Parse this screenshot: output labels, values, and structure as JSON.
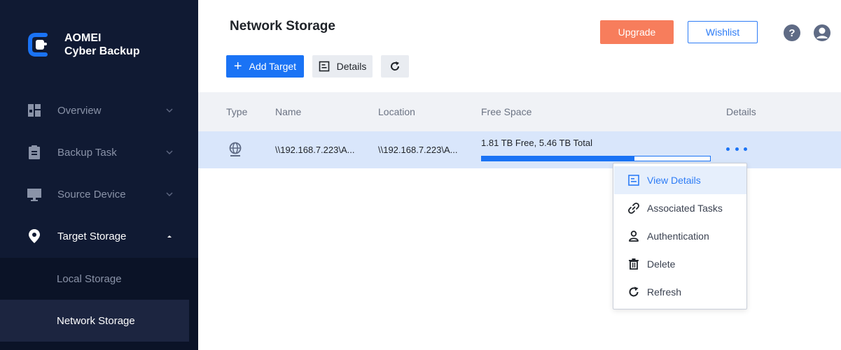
{
  "brand": {
    "line1": "AOMEI",
    "line2": "Cyber Backup"
  },
  "sidebar": {
    "items": [
      {
        "label": "Overview",
        "icon": "overview-icon"
      },
      {
        "label": "Backup Task",
        "icon": "clipboard-icon"
      },
      {
        "label": "Source Device",
        "icon": "monitor-icon"
      },
      {
        "label": "Target Storage",
        "icon": "location-pin-icon"
      }
    ],
    "submenu": [
      {
        "label": "Local Storage"
      },
      {
        "label": "Network Storage"
      }
    ]
  },
  "header": {
    "title": "Network Storage",
    "upgrade_label": "Upgrade",
    "wishlist_label": "Wishlist"
  },
  "toolbar": {
    "add_label": "Add Target",
    "details_label": "Details"
  },
  "table": {
    "columns": [
      "Type",
      "Name",
      "Location",
      "Free Space",
      "Details"
    ],
    "rows": [
      {
        "type_icon": "globe-icon",
        "name": "\\\\192.168.7.223\\A...",
        "location": "\\\\192.168.7.223\\A...",
        "free_space": "1.81 TB Free, 5.46 TB Total",
        "used_fraction": 0.67
      }
    ]
  },
  "menu": {
    "items": [
      {
        "label": "View Details",
        "icon": "details-icon"
      },
      {
        "label": "Associated Tasks",
        "icon": "link-icon"
      },
      {
        "label": "Authentication",
        "icon": "user-icon"
      },
      {
        "label": "Delete",
        "icon": "trash-icon"
      },
      {
        "label": "Refresh",
        "icon": "refresh-icon"
      }
    ]
  },
  "colors": {
    "sidebar_bg": "#101a33",
    "accent": "#1a73f5",
    "upgrade": "#f77d5c",
    "row_selected": "#d9e6fb"
  }
}
